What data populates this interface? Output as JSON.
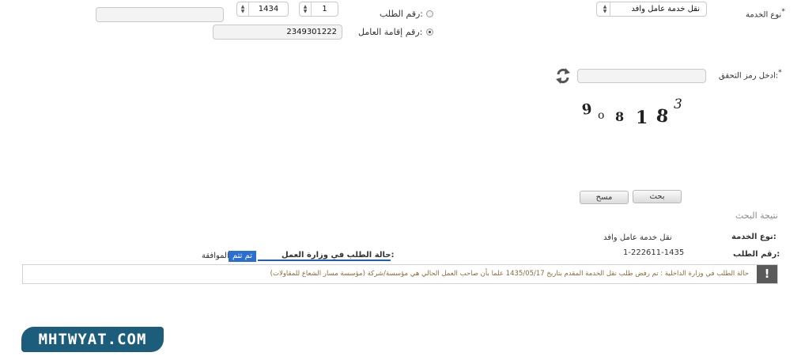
{
  "form": {
    "service_type_label": "نوع الخدمة",
    "service_type_value": "نقل خدمة عامل وافد",
    "request_number_label": "رقم الطلب:",
    "request_seq_value": "1",
    "request_year_value": "1434",
    "iqama_label": "رقم إقامة العامل:",
    "iqama_value": "2349301222",
    "captcha_label": "ادخل رمز التحقق:",
    "captcha_value": "",
    "captcha_text": [
      "9",
      "o",
      "8",
      "1",
      "8",
      "3"
    ],
    "required_mark": "*",
    "search_label": "بحث",
    "clear_label": "مسح"
  },
  "result": {
    "heading": "نتيجة البحث",
    "service_type_label": "نوع الخدمة:",
    "service_type_value": "نقل خدمة عامل وافد",
    "request_number_label": "رقم الطلب:",
    "request_number_value": "1-222611-1435",
    "mol_status_label": "حالة الطلب في وزارة العمل:",
    "mol_status_highlight": "تم تتم",
    "mol_status_value": "الموافقة",
    "notice_text": "حالة الطلب في وزارة الداخلية : تم رفض طلب نقل الخدمة المقدم بتاريخ 1435/05/17 علما بأن صاحب العمل الحالي هي مؤسسة/شركة (مؤسسة مسار الشعاع للمقاولات)",
    "notice_icon": "exclamation-icon"
  },
  "watermark": "MHTWYAT.COM",
  "colors": {
    "highlight": "#2b6fd1",
    "underline": "#1f5fc4",
    "notice_text": "#8b6a3d",
    "watermark_bg": "#1d5d7c"
  }
}
